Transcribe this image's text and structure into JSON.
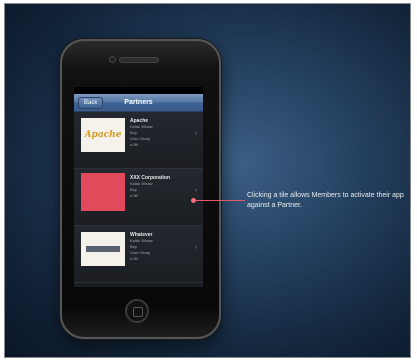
{
  "phone": {
    "status": {
      "left": "",
      "right": ""
    },
    "nav": {
      "back_label": "Back",
      "title": "Partners"
    },
    "tiles": [
      {
        "title": "Apache",
        "lines": [
          "Kaldu Whaw",
          "Bxp",
          "Lfwo Oloop",
          "o:3tf"
        ]
      },
      {
        "title": "XXX Corporation",
        "lines": [
          "Kaldu Whaw",
          "Bxp",
          "o:3tf"
        ]
      },
      {
        "title": "Whatever",
        "lines": [
          "Kaldu Whaw",
          "Bxp",
          "Lfwo Oloop",
          "o:3tf"
        ]
      }
    ]
  },
  "callout": {
    "text": "Clicking a tile allows Members to activate their app against a Partner."
  },
  "colors": {
    "accent_red": "#e25a6a",
    "nav_blue": "#3f6395"
  }
}
